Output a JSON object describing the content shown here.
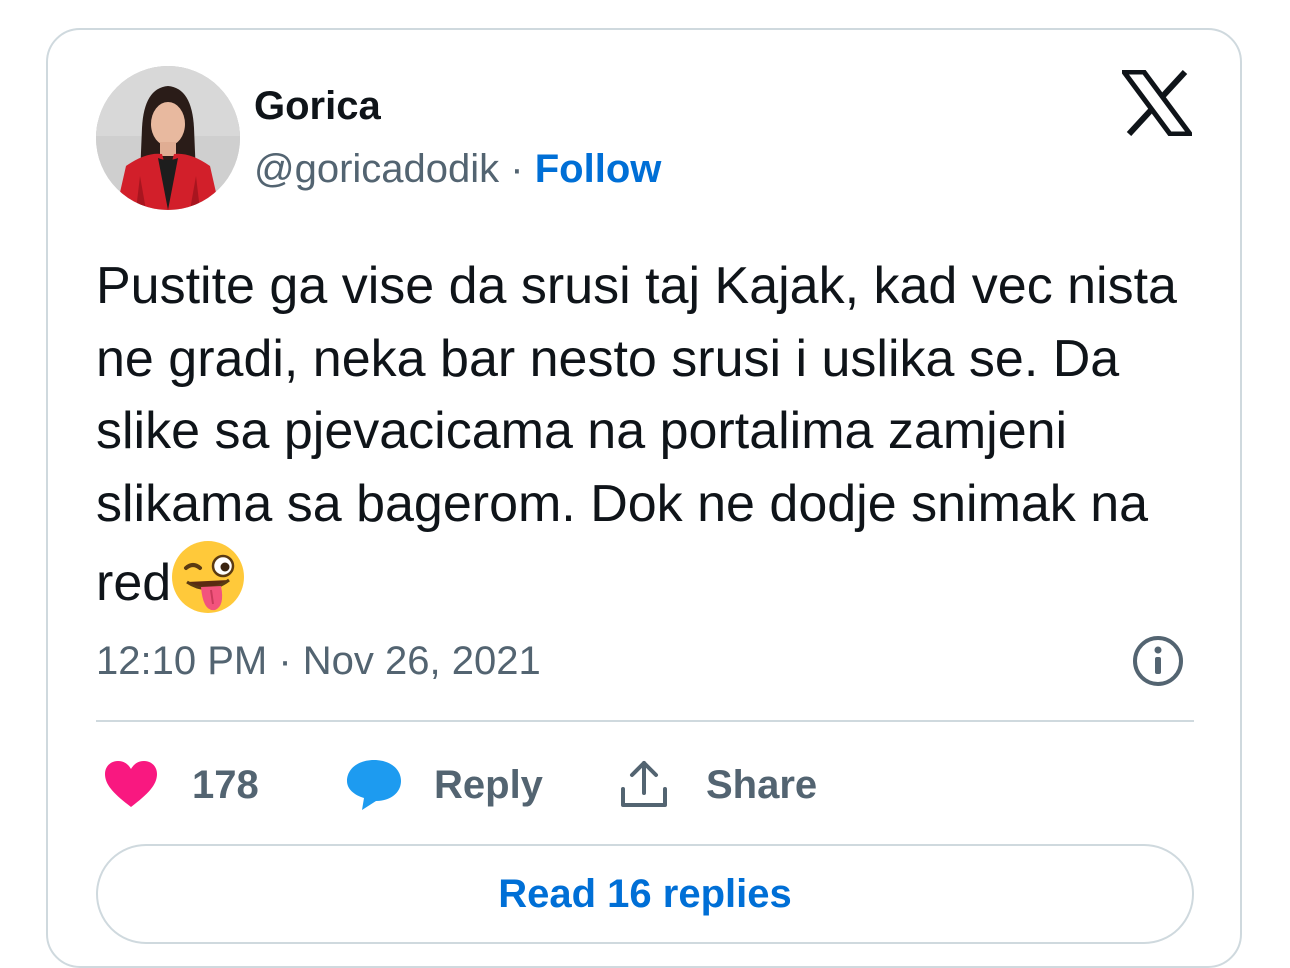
{
  "author": {
    "display_name": "Gorica",
    "handle": "@goricadodik",
    "separator": " · ",
    "follow_label": "Follow"
  },
  "tweet": {
    "text": "Pustite ga vise da srusi taj Kajak, kad vec nista ne gradi, neka bar nesto srusi i uslika se. Da slike sa pjevacicama na portalima zamjeni slikama sa bagerom. Dok ne dodje snimak na red",
    "emoji": "winking-face-with-tongue",
    "timestamp": "12:10 PM · Nov 26, 2021"
  },
  "actions": {
    "like_count": "178",
    "reply_label": "Reply",
    "share_label": "Share"
  },
  "read_replies_label": "Read 16 replies",
  "colors": {
    "like": "#f91880",
    "reply_bubble": "#1d9bf0",
    "link": "#006fd6",
    "muted": "#536471",
    "border": "#cfd9de"
  },
  "icons": {
    "platform": "x-logo-icon",
    "info": "info-icon",
    "like": "heart-icon",
    "reply": "speech-bubble-icon",
    "share": "upload-share-icon"
  }
}
